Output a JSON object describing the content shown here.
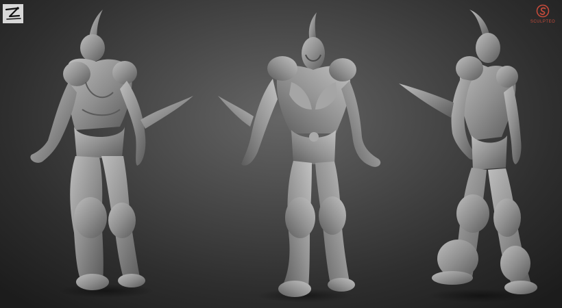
{
  "viewport": {
    "background_center": "#666666",
    "background_edge": "#1c1c1c",
    "model_color": "#9a9a9a"
  },
  "logo": {
    "icon": "zbrush-logo-icon"
  },
  "watermark": {
    "icon": "sculpteo-logo-icon",
    "text": "SCULPTEO",
    "color": "#c44a3a"
  },
  "renders": [
    {
      "view": "back-three-quarter",
      "icon": "sculpt-figure-back"
    },
    {
      "view": "front",
      "icon": "sculpt-figure-front"
    },
    {
      "view": "side-three-quarter",
      "icon": "sculpt-figure-side"
    }
  ]
}
